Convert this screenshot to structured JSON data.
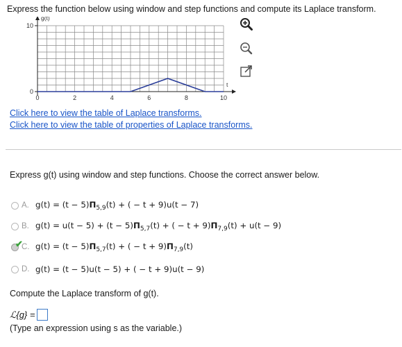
{
  "question": {
    "prompt": "Express the function below using window and step functions and compute its Laplace transform."
  },
  "graph": {
    "y_label": "g(t)",
    "x_label": "t",
    "y_ticks": [
      "10",
      "0"
    ],
    "x_ticks": [
      "0",
      "2",
      "4",
      "6",
      "8",
      "10"
    ]
  },
  "chart_data": {
    "type": "line",
    "title": "",
    "xlabel": "t",
    "ylabel": "g(t)",
    "xlim": [
      0,
      10
    ],
    "ylim": [
      0,
      10
    ],
    "grid": true,
    "x": [
      0,
      5,
      7,
      9,
      10
    ],
    "y": [
      0,
      0,
      2,
      0,
      0
    ]
  },
  "tools": {
    "zoom_in": "zoom-in-icon",
    "zoom_out": "zoom-out-icon",
    "popout": "popout-icon"
  },
  "links": {
    "transforms": "Click here to view the table of Laplace transforms.",
    "properties": "Click here to view the table of properties of Laplace transforms."
  },
  "part1": {
    "instruction": "Express g(t) using window and step functions. Choose the correct answer below.",
    "selected": "C",
    "correct_color": "#3aa13a"
  },
  "options": [
    {
      "label": "A.",
      "t1": "g(t) = (t − 5)",
      "s1": "5,9",
      "t2": "(t) + ( − t + 9)u(t − 7)",
      "s2": "",
      "t3": ""
    },
    {
      "label": "B.",
      "t1": "g(t) = u(t − 5) + (t − 5)",
      "s1": "5,7",
      "t2": "(t) + ( − t + 9)",
      "s2": "7,9",
      "t3": "(t) + u(t − 9)"
    },
    {
      "label": "C.",
      "t1": "g(t) = (t − 5)",
      "s1": "5,7",
      "t2": "(t) + ( − t + 9)",
      "s2": "7,9",
      "t3": "(t)"
    },
    {
      "label": "D.",
      "t1": "g(t) = (t − 5)u(t − 5) + ( − t + 9)u(t − 9)",
      "s1": "",
      "t2": "",
      "s2": "",
      "t3": ""
    }
  ],
  "part2": {
    "question": "Compute the Laplace transform of g(t).",
    "lhs": "ℒ{g} =",
    "hint": "(Type an expression using s as the variable.)"
  }
}
